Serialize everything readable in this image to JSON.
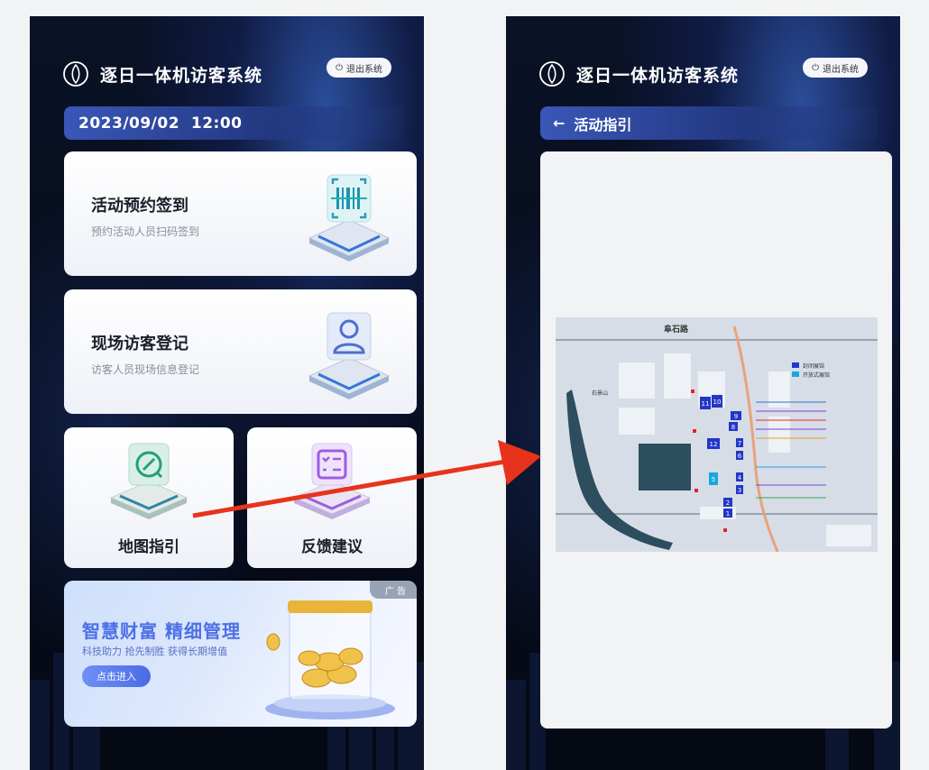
{
  "app": {
    "title": "逐日一体机访客系统",
    "logout_label": "退出系统"
  },
  "left": {
    "datetime": "2023/09/02  12:00",
    "cards": [
      {
        "title": "活动预约签到",
        "subtitle": "预约活动人员扫码签到",
        "icon": "barcode-scan-icon"
      },
      {
        "title": "现场访客登记",
        "subtitle": "访客人员现场信息登记",
        "icon": "person-icon"
      }
    ],
    "tiles": [
      {
        "title": "地图指引",
        "icon": "compass-icon"
      },
      {
        "title": "反馈建议",
        "icon": "checklist-icon"
      }
    ],
    "ad": {
      "badge": "广 告",
      "headline": "智慧财富 精细管理",
      "sub": "科技助力 抢先制胜 获得长期增值",
      "button": "点击进入"
    }
  },
  "right": {
    "back_icon": "arrow-left-icon",
    "page_title": "活动指引",
    "map": {
      "road_top": "阜石路",
      "place_left": "石景山",
      "legend": [
        "封闭展馆",
        "开放式展馆"
      ],
      "hall_numbers": [
        "11",
        "10",
        "9",
        "8",
        "12",
        "7",
        "6",
        "5",
        "4",
        "3",
        "2",
        "1"
      ],
      "colors": {
        "closed": "#2336c8",
        "open": "#19a6e0",
        "water": "#2d4e5e",
        "road": "#e8a27c"
      }
    }
  },
  "colors": {
    "accent_blue": "#3a57b8",
    "arrow_red": "#e8331c",
    "bg_dark": "#0a1226"
  }
}
